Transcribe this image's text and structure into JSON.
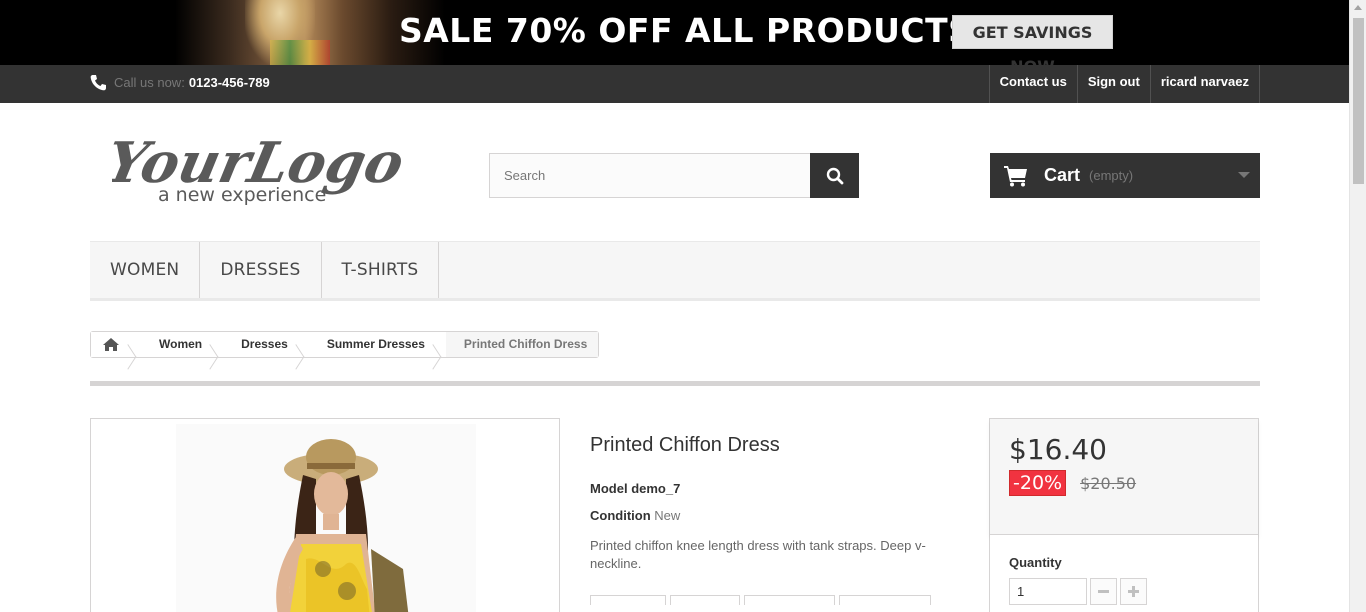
{
  "banner": {
    "sale_text": "SALE 70% OFF ALL PRODUCTS",
    "cta_label": "GET SAVINGS NOW"
  },
  "topnav": {
    "call_label": "Call us now:",
    "phone": "0123-456-789",
    "links": [
      "Contact us",
      "Sign out",
      "ricard narvaez"
    ]
  },
  "header": {
    "logo_text": "YourLogo",
    "logo_tagline": "a new experience",
    "search_placeholder": "Search",
    "cart_label": "Cart",
    "cart_status": "(empty)"
  },
  "menu": {
    "items": [
      "WOMEN",
      "DRESSES",
      "T-SHIRTS"
    ]
  },
  "breadcrumb": {
    "items": [
      "Women",
      "Dresses",
      "Summer Dresses",
      "Printed Chiffon Dress"
    ]
  },
  "product": {
    "title": "Printed Chiffon Dress",
    "model_label": "Model",
    "model_value": "demo_7",
    "condition_label": "Condition",
    "condition_value": "New",
    "description": "Printed chiffon knee length dress with tank straps. Deep v-neckline.",
    "price": "$16.40",
    "discount": "-20%",
    "old_price": "$20.50",
    "quantity_label": "Quantity",
    "quantity_value": "1"
  },
  "colors": {
    "dark": "#333333",
    "discount_red": "#f13340",
    "light_bg": "#f6f6f6",
    "border": "#d6d4d4"
  }
}
